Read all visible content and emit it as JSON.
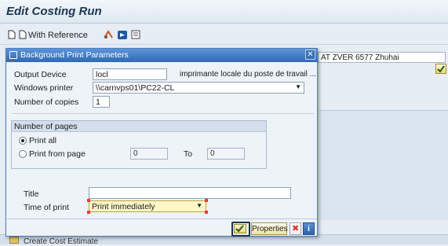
{
  "window": {
    "title": "Edit Costing Run"
  },
  "toolbar": {
    "with_reference_label": "With Reference"
  },
  "background": {
    "plant_field": "AT ZVER 6577 Zhuhai",
    "create_cost_estimate": "Create Cost Estimate"
  },
  "dialog": {
    "title": "Background Print Parameters",
    "output_device": {
      "label": "Output Device",
      "value": "locl",
      "description": "imprimante locale du poste de travail ..."
    },
    "windows_printer": {
      "label": "Windows printer",
      "value": "\\\\carnvps01\\PC22-CL"
    },
    "copies": {
      "label": "Number of copies",
      "value": "1"
    },
    "pages": {
      "group_title": "Number of pages",
      "print_all_label": "Print all",
      "print_from_label": "Print from page",
      "from_value": "0",
      "to_label": "To",
      "to_value": "0",
      "selected": "Print all"
    },
    "title_field": {
      "label": "Title",
      "value": ""
    },
    "time_of_print": {
      "label": "Time of print",
      "value": "Print immediately"
    },
    "buttons": {
      "properties": "Properties",
      "info": "i",
      "cancel": "✖",
      "close": "✕"
    }
  },
  "colors": {
    "header_blue": "#2f6ab5",
    "confirm_yellow": "#f0d76b",
    "cancel_red": "#d23a2d"
  }
}
